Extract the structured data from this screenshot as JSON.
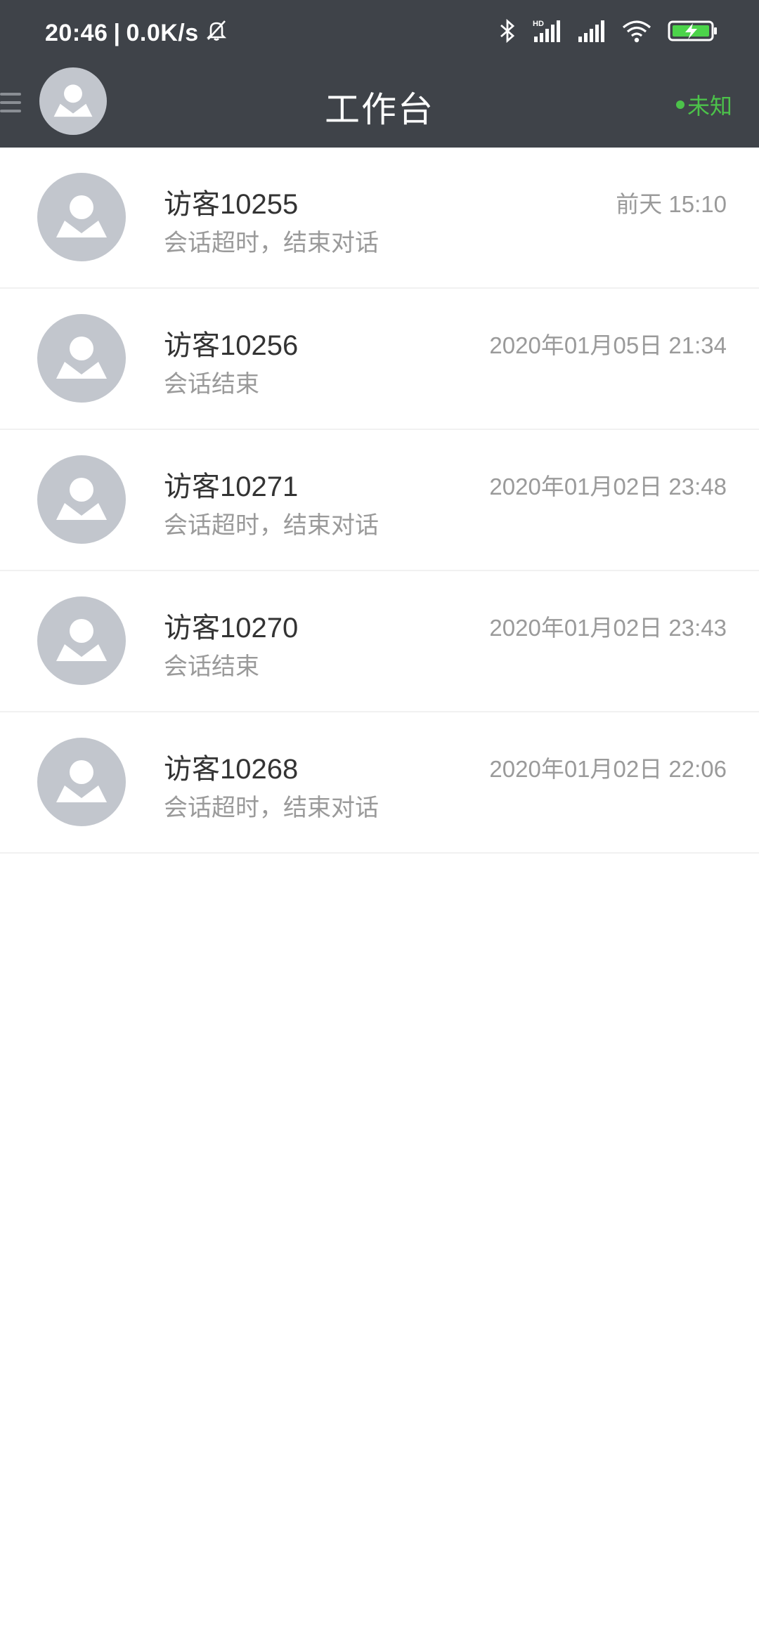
{
  "status_bar": {
    "time": "20:46",
    "separator": "|",
    "network_speed": "0.0K/s",
    "icons": [
      "mute-bell-icon",
      "bluetooth-icon",
      "hd-signal-icon",
      "signal-icon",
      "wifi-icon",
      "battery-charging-icon"
    ],
    "hd_label": "HD"
  },
  "header": {
    "title": "工作台",
    "status_label": "未知",
    "status_color": "#4cc24a",
    "background": "#3f4349"
  },
  "conversations": [
    {
      "name": "访客10255",
      "last_message": "会话超时，结束对话",
      "time": "前天 15:10"
    },
    {
      "name": "访客10256",
      "last_message": "会话结束",
      "time": "2020年01月05日 21:34"
    },
    {
      "name": "访客10271",
      "last_message": "会话超时，结束对话",
      "time": "2020年01月02日 23:48"
    },
    {
      "name": "访客10270",
      "last_message": "会话结束",
      "time": "2020年01月02日 23:43"
    },
    {
      "name": "访客10268",
      "last_message": "会话超时，结束对话",
      "time": "2020年01月02日 22:06"
    }
  ]
}
